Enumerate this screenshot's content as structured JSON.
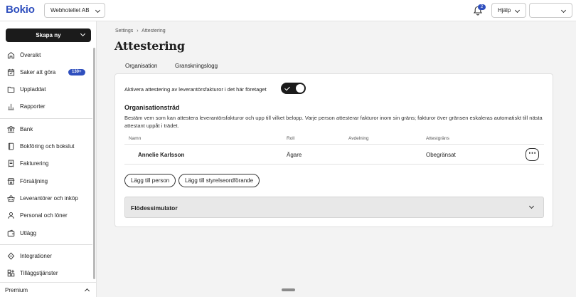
{
  "app": {
    "logo": "Bokio",
    "company": "Webhotellet AB"
  },
  "topbar": {
    "notification_count": "2",
    "help_label": "Hjälp",
    "user_menu": ""
  },
  "sidebar": {
    "create_label": "Skapa ny",
    "items": [
      {
        "label": "Översikt",
        "icon": "home-icon"
      },
      {
        "label": "Saker att göra",
        "icon": "calendar-check-icon",
        "badge": "130+"
      },
      {
        "label": "Uppladdat",
        "icon": "folder-icon"
      },
      {
        "label": "Rapporter",
        "icon": "bar-chart-icon"
      },
      {
        "label": "Bank",
        "icon": "bank-icon"
      },
      {
        "label": "Bokföring och bokslut",
        "icon": "book-icon"
      },
      {
        "label": "Fakturering",
        "icon": "invoice-icon"
      },
      {
        "label": "Försäljning",
        "icon": "store-icon"
      },
      {
        "label": "Leverantörer och inköp",
        "icon": "basket-icon"
      },
      {
        "label": "Personal och löner",
        "icon": "person-icon"
      },
      {
        "label": "Utlägg",
        "icon": "wallet-icon"
      },
      {
        "label": "Integrationer",
        "icon": "integrations-icon"
      },
      {
        "label": "Tilläggstjänster",
        "icon": "addons-icon"
      }
    ],
    "premium_label": "Premium"
  },
  "breadcrumb": {
    "parent": "Settings",
    "separator": "›",
    "current": "Attestering"
  },
  "page": {
    "title": "Attestering"
  },
  "tabs": [
    {
      "label": "Organisation",
      "active": true
    },
    {
      "label": "Granskningslogg",
      "active": false
    }
  ],
  "settings": {
    "toggle_label": "Aktivera attestering av leverantörsfakturor i det här företaget",
    "toggle_on": true
  },
  "org_tree": {
    "heading": "Organisationsträd",
    "description": "Bestäm vem som kan attestera leverantörsfakturor och upp till vilket belopp. Varje person attesterar fakturor inom sin gräns; fakturor över gränsen eskaleras automatiskt till nästa attestant uppåt i trädet.",
    "columns": [
      "Namn",
      "Roll",
      "Avdelning",
      "Attestgräns"
    ],
    "rows": [
      {
        "name": "Annelie Karlsson",
        "role": "Ägare",
        "department": "",
        "limit": "Obegränsat"
      }
    ],
    "add_person_label": "Lägg till person",
    "add_board_label": "Lägg till styrelseordförande"
  },
  "simulator": {
    "label": "Flödessimulator"
  },
  "colors": {
    "brand": "#2f4fbe",
    "dark": "#1b1b1b"
  }
}
